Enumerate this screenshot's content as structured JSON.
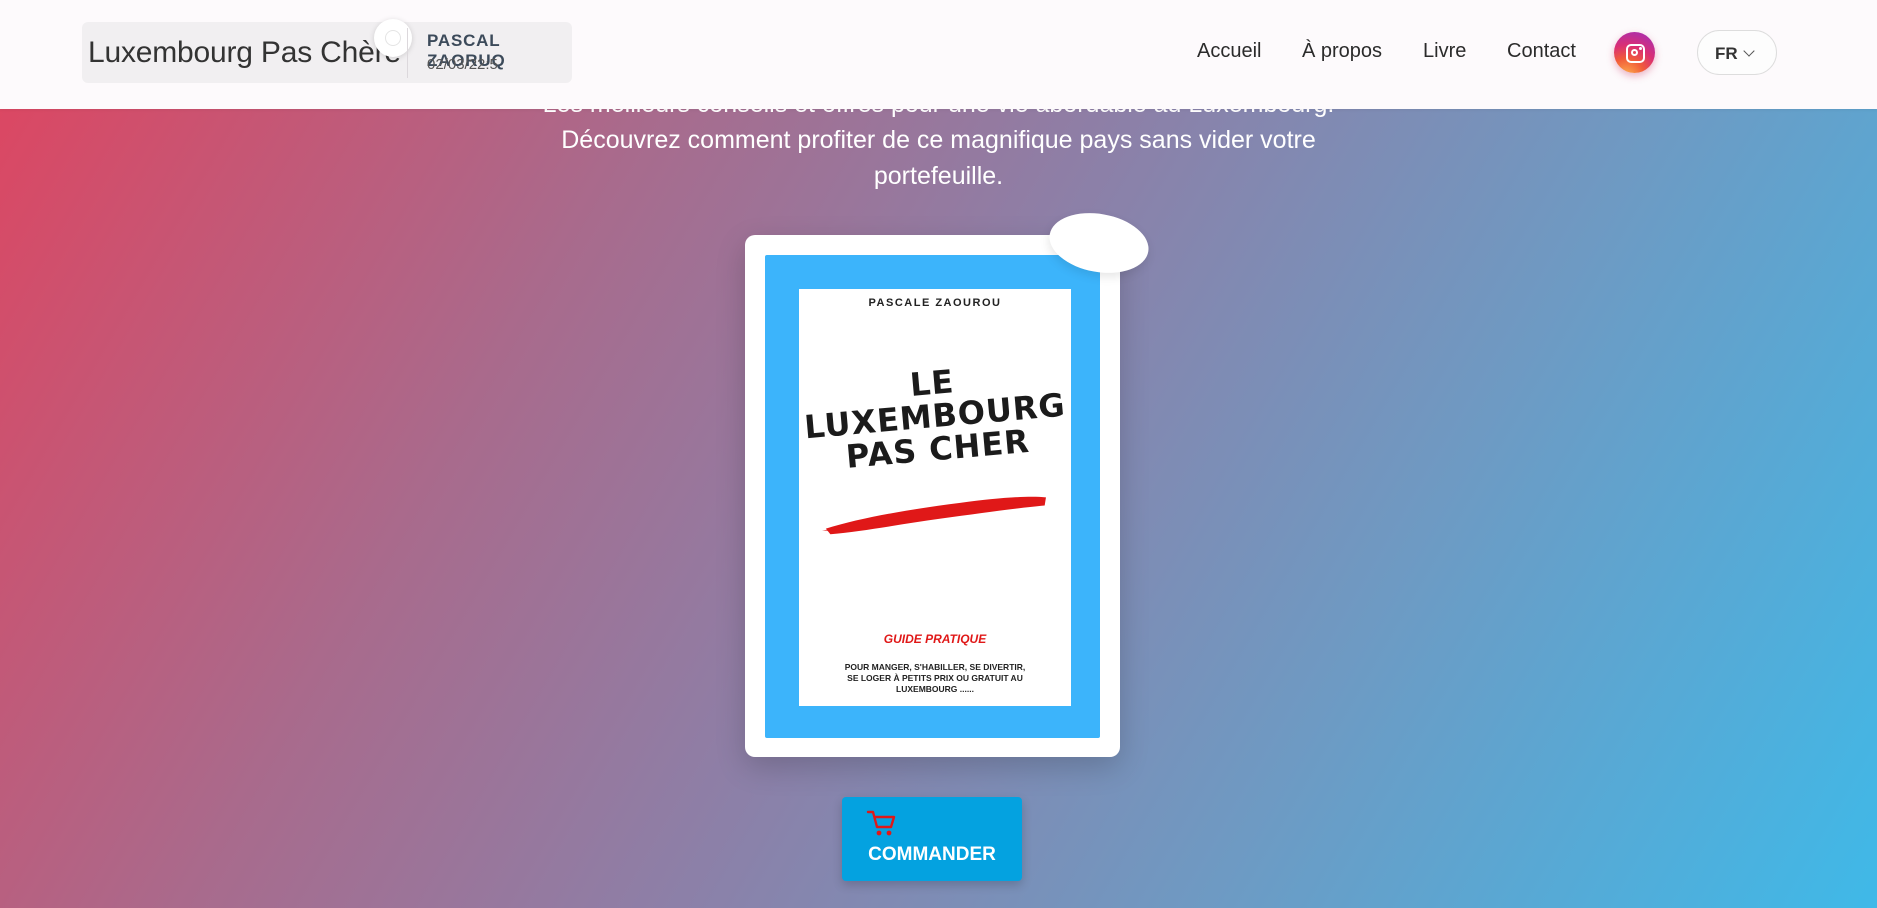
{
  "header": {
    "brand_title": "Luxembourg Pas Chère",
    "author": "PASCAL ZAORUQ",
    "date": "02/03/22:5",
    "nav": [
      {
        "label": "Accueil"
      },
      {
        "label": "À propos"
      },
      {
        "label": "Livre"
      },
      {
        "label": "Contact"
      }
    ],
    "social_icon": "instagram-icon",
    "language": "FR"
  },
  "hero": {
    "lines": [
      "Les meilleurs conseils et offres pour une vie abordable au Luxembourg.",
      "Découvrez comment profiter de ce magnifique pays sans vider votre",
      "portefeuille."
    ]
  },
  "book": {
    "author": "PASCALE ZAOUROU",
    "title_lines": [
      "LE",
      "LUXEMBOURG",
      "PAS CHER"
    ],
    "subtitle": "GUIDE PRATIQUE",
    "description_lines": [
      "POUR MANGER, S'HABILLER, SE DIVERTIR,",
      "SE LOGER À PETITS PRIX OU GRATUIT AU",
      "LUXEMBOURG ......"
    ]
  },
  "order": {
    "label": "COMMANDER",
    "icon": "cart-icon"
  },
  "colors": {
    "accent_blue": "#04a2e0",
    "book_frame": "#3cb4fb",
    "brush_red": "#e01818",
    "gradient_start": "#e0445f",
    "gradient_end": "#3fb9e8"
  }
}
